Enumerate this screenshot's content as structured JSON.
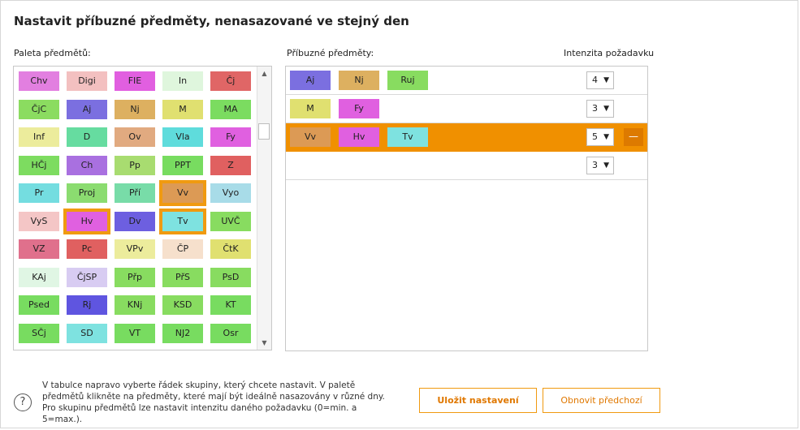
{
  "title": "Nastavit příbuzné předměty, nenasazované ve stejný den",
  "palette_label": "Paleta předmětů:",
  "groups_label": "Příbuzné předměty:",
  "intensity_label": "Intenzita požadavku",
  "palette": [
    {
      "label": "Chv",
      "color": "#e27fe0",
      "selected": false
    },
    {
      "label": "Digi",
      "color": "#f3c0c0",
      "selected": false
    },
    {
      "label": "FIE",
      "color": "#e15fe0",
      "selected": false
    },
    {
      "label": "In",
      "color": "#dff6dd",
      "selected": false
    },
    {
      "label": "Čj",
      "color": "#e06666",
      "selected": false
    },
    {
      "label": "ČjC",
      "color": "#8bdc60",
      "selected": false
    },
    {
      "label": "Aj",
      "color": "#7b6fe0",
      "selected": false
    },
    {
      "label": "Nj",
      "color": "#ddb060",
      "selected": false
    },
    {
      "label": "M",
      "color": "#e0e070",
      "selected": false
    },
    {
      "label": "MA",
      "color": "#7bdc60",
      "selected": false
    },
    {
      "label": "Inf",
      "color": "#ecec9c",
      "selected": false
    },
    {
      "label": "D",
      "color": "#66dca0",
      "selected": false
    },
    {
      "label": "Ov",
      "color": "#e1aa80",
      "selected": false
    },
    {
      "label": "Vla",
      "color": "#5fdcdc",
      "selected": false
    },
    {
      "label": "Fy",
      "color": "#e060e0",
      "selected": false
    },
    {
      "label": "HČj",
      "color": "#7ddc60",
      "selected": false
    },
    {
      "label": "Ch",
      "color": "#a970e0",
      "selected": false
    },
    {
      "label": "Pp",
      "color": "#a8dc70",
      "selected": false
    },
    {
      "label": "PPT",
      "color": "#78dc60",
      "selected": false
    },
    {
      "label": "Z",
      "color": "#e06060",
      "selected": false
    },
    {
      "label": "Pr",
      "color": "#74dde0",
      "selected": false
    },
    {
      "label": "Proj",
      "color": "#8bdc70",
      "selected": false
    },
    {
      "label": "Pří",
      "color": "#78dca8",
      "selected": false
    },
    {
      "label": "Vv",
      "color": "#dc9a55",
      "selected": true
    },
    {
      "label": "Vyo",
      "color": "#a8dce8",
      "selected": false
    },
    {
      "label": "VyS",
      "color": "#f4c6c6",
      "selected": false
    },
    {
      "label": "Hv",
      "color": "#e060e0",
      "selected": true
    },
    {
      "label": "Dv",
      "color": "#6d5fe0",
      "selected": false
    },
    {
      "label": "Tv",
      "color": "#7ee2e0",
      "selected": true
    },
    {
      "label": "UVČ",
      "color": "#88dc60",
      "selected": false
    },
    {
      "label": "VZ",
      "color": "#e0708c",
      "selected": false
    },
    {
      "label": "Pc",
      "color": "#e06060",
      "selected": false
    },
    {
      "label": "VPv",
      "color": "#ecec9c",
      "selected": false
    },
    {
      "label": "ČP",
      "color": "#f6e0cc",
      "selected": false
    },
    {
      "label": "ČtK",
      "color": "#e0e070",
      "selected": false
    },
    {
      "label": "KAj",
      "color": "#e0f6e4",
      "selected": false
    },
    {
      "label": "ČjSP",
      "color": "#d8ccf2",
      "selected": false
    },
    {
      "label": "Přp",
      "color": "#88dc60",
      "selected": false
    },
    {
      "label": "PřS",
      "color": "#88dc60",
      "selected": false
    },
    {
      "label": "PsD",
      "color": "#88dc60",
      "selected": false
    },
    {
      "label": "Psed",
      "color": "#78dc60",
      "selected": false
    },
    {
      "label": "Rj",
      "color": "#5f55e0",
      "selected": false
    },
    {
      "label": "KNj",
      "color": "#88dc60",
      "selected": false
    },
    {
      "label": "KSD",
      "color": "#88dc60",
      "selected": false
    },
    {
      "label": "KT",
      "color": "#78dc60",
      "selected": false
    },
    {
      "label": "SČj",
      "color": "#78dc60",
      "selected": false
    },
    {
      "label": "SD",
      "color": "#7ee2e0",
      "selected": false
    },
    {
      "label": "VT",
      "color": "#78dc60",
      "selected": false
    },
    {
      "label": "NJ2",
      "color": "#78dc60",
      "selected": false
    },
    {
      "label": "Osr",
      "color": "#78dc60",
      "selected": false
    }
  ],
  "groups": [
    {
      "subjects": [
        {
          "label": "Aj",
          "color": "#7b6fe0"
        },
        {
          "label": "Nj",
          "color": "#ddb060"
        },
        {
          "label": "Ruj",
          "color": "#88dc60"
        }
      ],
      "intensity": "4",
      "active": false
    },
    {
      "subjects": [
        {
          "label": "M",
          "color": "#e0e070"
        },
        {
          "label": "Fy",
          "color": "#e060e0"
        }
      ],
      "intensity": "3",
      "active": false
    },
    {
      "subjects": [
        {
          "label": "Vv",
          "color": "#dc9a55"
        },
        {
          "label": "Hv",
          "color": "#e060e0"
        },
        {
          "label": "Tv",
          "color": "#7ee2e0"
        }
      ],
      "intensity": "5",
      "active": true
    },
    {
      "subjects": [],
      "intensity": "3",
      "active": false
    }
  ],
  "help_text": "V tabulce napravo vyberte řádek skupiny, který chcete nastavit. V paletě předmětů klikněte na předměty, které mají být ideálně nasazovány v různé dny. Pro skupinu předmětů lze nastavit intenzitu daného požadavku (0=min. a 5=max.).",
  "buttons": {
    "save": "Uložit nastavení",
    "restore": "Obnovit předchozí"
  },
  "icons": {
    "help": "?",
    "remove": "—",
    "dropdown": "▼",
    "scroll_up": "▲",
    "scroll_down": "▼"
  },
  "accent_color": "#f09a10"
}
